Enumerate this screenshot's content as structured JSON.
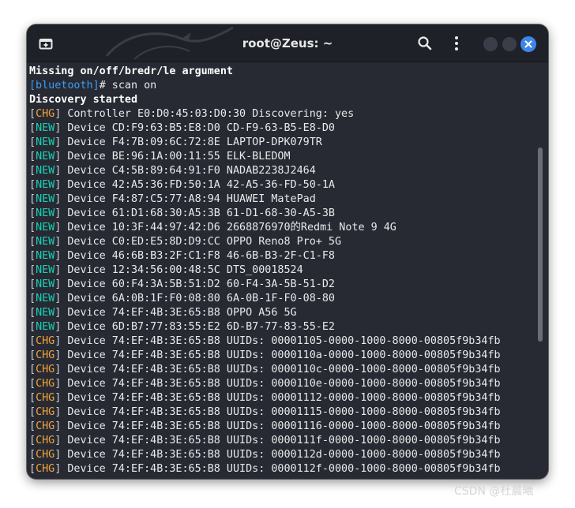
{
  "window": {
    "title": "root@Zeus: ~"
  },
  "terminal": {
    "lines": [
      {
        "plain": "Missing on/off/bredr/le argument"
      },
      {
        "prompt": "[bluetooth]",
        "text": "# scan on"
      },
      {
        "plain": "Discovery started"
      },
      {
        "tag": "CHG",
        "text": " Controller E0:D0:45:03:D0:30 Discovering: yes"
      },
      {
        "tag": "NEW",
        "text": " Device CD:F9:63:B5:E8:D0 CD-F9-63-B5-E8-D0"
      },
      {
        "tag": "NEW",
        "text": " Device F4:7B:09:6C:72:8E LAPTOP-DPK079TR"
      },
      {
        "tag": "NEW",
        "text": " Device BE:96:1A:00:11:55 ELK-BLEDOM"
      },
      {
        "tag": "NEW",
        "text": " Device C4:5B:89:64:91:F0 NADAB2238J2464"
      },
      {
        "tag": "NEW",
        "text": " Device 42:A5:36:FD:50:1A 42-A5-36-FD-50-1A"
      },
      {
        "tag": "NEW",
        "text": " Device F4:87:C5:77:A8:94 HUAWEI MatePad"
      },
      {
        "tag": "NEW",
        "text": " Device 61:D1:68:30:A5:3B 61-D1-68-30-A5-3B"
      },
      {
        "tag": "NEW",
        "text": " Device 10:3F:44:97:42:D6 2668876970的Redmi Note 9 4G"
      },
      {
        "tag": "NEW",
        "text": " Device C0:ED:E5:8D:D9:CC OPPO Reno8 Pro+ 5G"
      },
      {
        "tag": "NEW",
        "text": " Device 46:6B:B3:2F:C1:F8 46-6B-B3-2F-C1-F8"
      },
      {
        "tag": "NEW",
        "text": " Device 12:34:56:00:48:5C DTS_00018524"
      },
      {
        "tag": "NEW",
        "text": " Device 60:F4:3A:5B:51:D2 60-F4-3A-5B-51-D2"
      },
      {
        "tag": "NEW",
        "text": " Device 6A:0B:1F:F0:08:80 6A-0B-1F-F0-08-80"
      },
      {
        "tag": "NEW",
        "text": " Device 74:EF:4B:3E:65:B8 OPPO A56 5G"
      },
      {
        "tag": "NEW",
        "text": " Device 6D:B7:77:83:55:E2 6D-B7-77-83-55-E2"
      },
      {
        "tag": "CHG",
        "text": " Device 74:EF:4B:3E:65:B8 UUIDs: 00001105-0000-1000-8000-00805f9b34fb"
      },
      {
        "tag": "CHG",
        "text": " Device 74:EF:4B:3E:65:B8 UUIDs: 0000110a-0000-1000-8000-00805f9b34fb"
      },
      {
        "tag": "CHG",
        "text": " Device 74:EF:4B:3E:65:B8 UUIDs: 0000110c-0000-1000-8000-00805f9b34fb"
      },
      {
        "tag": "CHG",
        "text": " Device 74:EF:4B:3E:65:B8 UUIDs: 0000110e-0000-1000-8000-00805f9b34fb"
      },
      {
        "tag": "CHG",
        "text": " Device 74:EF:4B:3E:65:B8 UUIDs: 00001112-0000-1000-8000-00805f9b34fb"
      },
      {
        "tag": "CHG",
        "text": " Device 74:EF:4B:3E:65:B8 UUIDs: 00001115-0000-1000-8000-00805f9b34fb"
      },
      {
        "tag": "CHG",
        "text": " Device 74:EF:4B:3E:65:B8 UUIDs: 00001116-0000-1000-8000-00805f9b34fb"
      },
      {
        "tag": "CHG",
        "text": " Device 74:EF:4B:3E:65:B8 UUIDs: 0000111f-0000-1000-8000-00805f9b34fb"
      },
      {
        "tag": "CHG",
        "text": " Device 74:EF:4B:3E:65:B8 UUIDs: 0000112d-0000-1000-8000-00805f9b34fb"
      },
      {
        "tag": "CHG",
        "text": " Device 74:EF:4B:3E:65:B8 UUIDs: 0000112f-0000-1000-8000-00805f9b34fb"
      }
    ]
  },
  "watermark": "CSDN @杜晨曦",
  "icons": {
    "new_tab": "new-tab-icon",
    "search": "search-icon",
    "menu": "kebab-menu-icon",
    "close": "close-icon"
  },
  "colors": {
    "window_bg": "#272a33",
    "titlebar_bg": "#1f2128",
    "prompt": "#3d9df2",
    "new_tag": "#19d1b4",
    "chg_tag": "#f2a23a",
    "close_button": "#3d86e8"
  }
}
